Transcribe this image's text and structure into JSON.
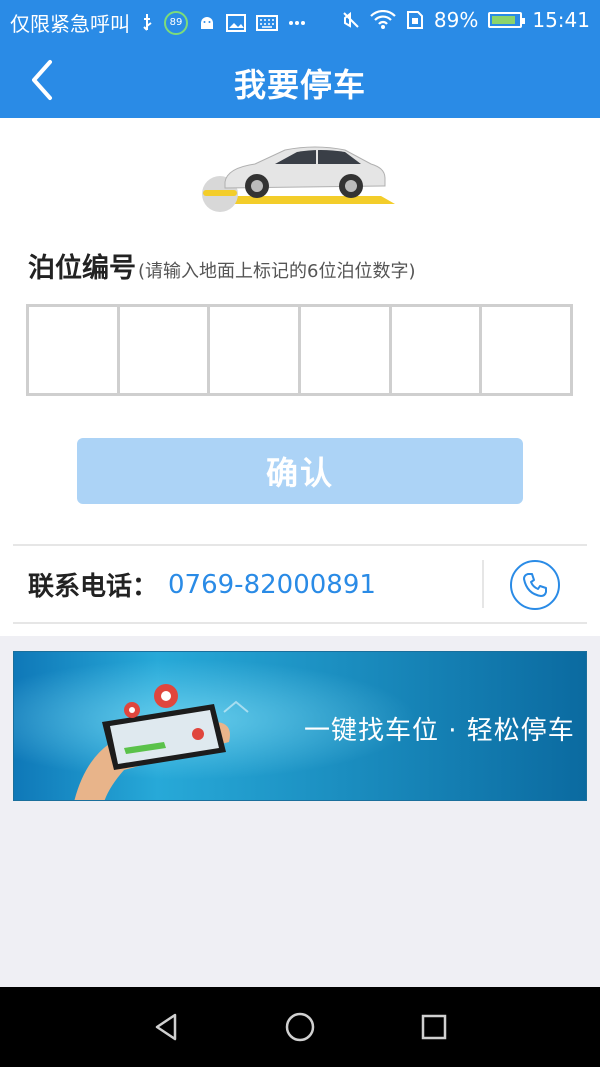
{
  "status_bar": {
    "carrier_text": "仅限紧急呼叫",
    "badge_number": "89",
    "battery_percent": "89%",
    "battery_level": 0.89,
    "time": "15:41",
    "icons": [
      "usb-icon",
      "android-icon",
      "image-icon",
      "keyboard-icon",
      "more-dots-icon",
      "mute-icon",
      "wifi-icon",
      "sim-icon",
      "battery-icon"
    ]
  },
  "header": {
    "title": "我要停车",
    "back_icon": "back-arrow-icon",
    "bg_color": "#2a8be6"
  },
  "form": {
    "label_main": "泊位编号",
    "label_hint": "(请输入地面上标记的6位泊位数字)",
    "digit_boxes": [
      "",
      "",
      "",
      "",
      "",
      ""
    ],
    "confirm_label": "确认",
    "confirm_color": "#acd3f6"
  },
  "contact": {
    "label": "联系电话：",
    "phone": "0769-82000891",
    "icon": "phone-icon",
    "accent_color": "#2a8be6"
  },
  "banner": {
    "text": "一键找车位 · 轻松停车"
  },
  "nav_bar": {
    "icons": [
      "back-triangle-icon",
      "home-circle-icon",
      "recents-square-icon"
    ]
  }
}
